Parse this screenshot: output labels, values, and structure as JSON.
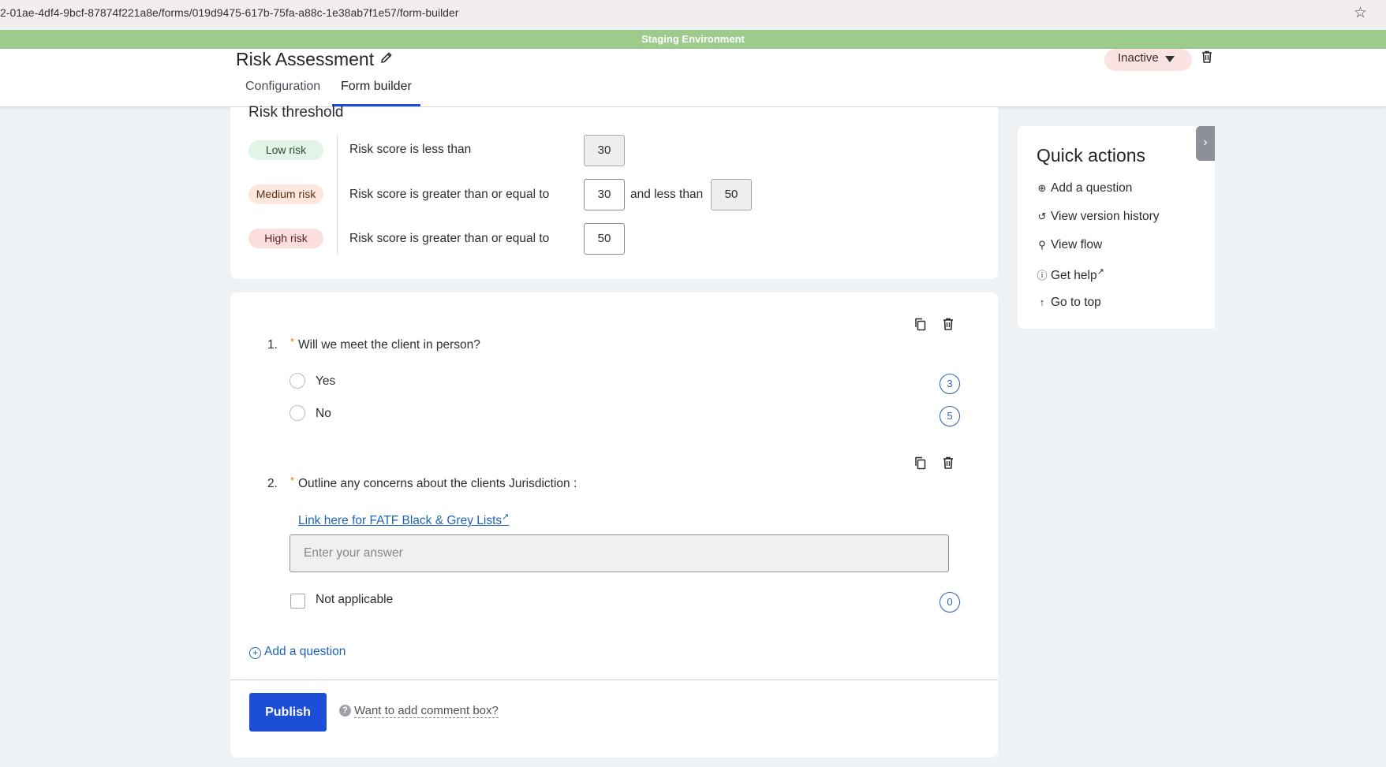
{
  "browser": {
    "url": "2-01ae-4df4-9bcf-87874f221a8e/forms/019d9475-617b-75fa-a88c-1e38ab7f1e57/form-builder"
  },
  "banner": {
    "text": "Staging Environment",
    "color": "#9ccb8c"
  },
  "header": {
    "title": "Risk Assessment",
    "tabs": [
      {
        "label": "Configuration",
        "active": false
      },
      {
        "label": "Form builder",
        "active": true
      }
    ],
    "status": "Inactive"
  },
  "risk_threshold": {
    "title": "Risk threshold",
    "rows": [
      {
        "pill": "Low risk",
        "text": "Risk score is less than",
        "value": "30"
      },
      {
        "pill": "Medium risk",
        "text": "Risk score is greater than or equal to",
        "value": "30",
        "and_text": "and less than",
        "upper_value": "50"
      },
      {
        "pill": "High risk",
        "text": "Risk score is greater than or equal to",
        "value": "50"
      }
    ]
  },
  "questions": [
    {
      "number": "1.",
      "required_mark": "*",
      "text": "Will we meet the client in person?",
      "options": [
        {
          "label": "Yes",
          "score": "3"
        },
        {
          "label": "No",
          "score": "5"
        }
      ]
    },
    {
      "number": "2.",
      "required_mark": "*",
      "text": "Outline any concerns about the clients Jurisdiction :",
      "link": "Link here for FATF Black & Grey Lists",
      "link_ext": "↗",
      "placeholder": "Enter your answer",
      "na_label": "Not applicable",
      "na_score": "0"
    }
  ],
  "add_question": "Add a question",
  "publish": "Publish",
  "comment_help": "?",
  "comment_prompt": "Want to add comment box?",
  "quick_actions": {
    "title": "Quick actions",
    "items": [
      {
        "label": "Add a question",
        "icon": "plus-circle-icon"
      },
      {
        "label": "View version history",
        "icon": "history-icon"
      },
      {
        "label": "View flow",
        "icon": "flow-icon"
      },
      {
        "label": "Get help",
        "icon": "help-circle-icon",
        "ext": "↗"
      },
      {
        "label": "Go to top",
        "icon": "arrow-up-icon"
      }
    ]
  },
  "colors": {
    "accent": "#1d4ed8",
    "link": "#1d64b8",
    "score_ring": "#2f5fb5",
    "low_risk_bg": "#e2f4e7",
    "medium_risk_bg": "#fde6dc",
    "high_risk_bg": "#fbdede",
    "inactive_bg": "#fbe3e3"
  }
}
